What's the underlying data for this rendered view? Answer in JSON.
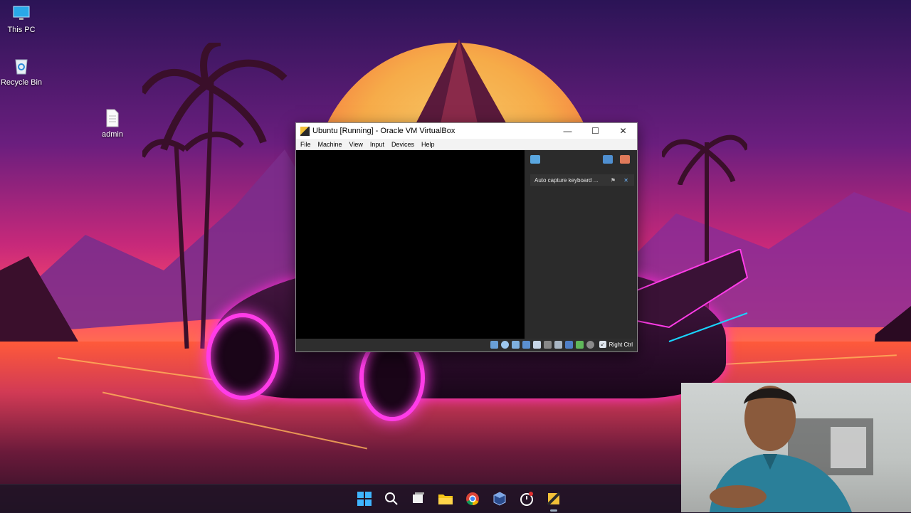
{
  "desktop": {
    "icons": [
      {
        "label": "This PC"
      },
      {
        "label": "Recycle Bin"
      },
      {
        "label": "admin"
      }
    ]
  },
  "window": {
    "title": "Ubuntu [Running] - Oracle VM VirtualBox",
    "menu": [
      "File",
      "Machine",
      "View",
      "Input",
      "Devices",
      "Help"
    ],
    "controls": {
      "minimize": "—",
      "maximize": "☐",
      "close": "✕"
    },
    "notification": {
      "text": "Auto capture keyboard ...",
      "pin_icon": "pin-icon",
      "close_icon": "close-icon"
    },
    "statusbar": {
      "host_key": "Right Ctrl"
    }
  },
  "taskbar": {
    "icons": [
      "windows-start-icon",
      "search-icon",
      "task-view-icon",
      "file-explorer-icon",
      "chrome-icon",
      "virtualbox-icon",
      "clock-app-icon",
      "vm-instance-icon"
    ]
  },
  "colors": {
    "vm_screen": "#000000",
    "notification_panel": "#2b2b2b",
    "accent": "#ff3ce8"
  }
}
